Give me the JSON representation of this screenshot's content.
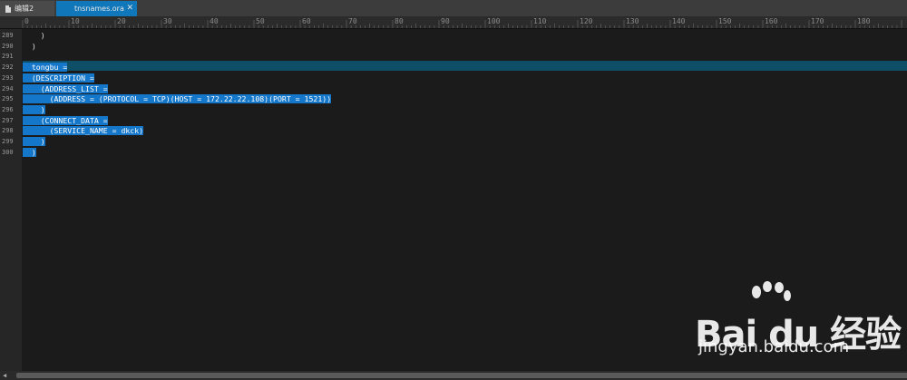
{
  "tabs": [
    {
      "label": "编辑2",
      "active": false
    },
    {
      "label": "tnsnames.ora",
      "active": true,
      "close": "✕"
    }
  ],
  "ruler": {
    "marks": [
      "0",
      "10",
      "20",
      "30",
      "40",
      "50",
      "60",
      "70",
      "80",
      "90",
      "100",
      "110",
      "120",
      "130",
      "140",
      "150",
      "160",
      "170",
      "180"
    ]
  },
  "lines": [
    {
      "num": "289",
      "text": "    )",
      "selected": false
    },
    {
      "num": "290",
      "text": "  )",
      "selected": false
    },
    {
      "num": "291",
      "text": "",
      "selected": false
    },
    {
      "num": "292",
      "text": "  tongbu =",
      "selected": true
    },
    {
      "num": "293",
      "text": "  (DESCRIPTION =",
      "selected": true
    },
    {
      "num": "294",
      "text": "    (ADDRESS_LIST =",
      "selected": true
    },
    {
      "num": "295",
      "text": "      (ADDRESS = (PROTOCOL = TCP)(HOST = 172.22.22.108)(PORT = 1521))",
      "selected": true
    },
    {
      "num": "296",
      "text": "    )",
      "selected": true
    },
    {
      "num": "297",
      "text": "    (CONNECT_DATA =",
      "selected": true
    },
    {
      "num": "298",
      "text": "      (SERVICE_NAME = dkck)",
      "selected": true
    },
    {
      "num": "299",
      "text": "    )",
      "selected": true
    },
    {
      "num": "300",
      "text": "  )",
      "selected": true
    }
  ],
  "watermark": {
    "brand": "Bai du 经验",
    "url": "jingyan.baidu.com"
  },
  "colors": {
    "tab_active": "#1177bb",
    "selection": "#1577c9",
    "current_line": "#0e4f67",
    "editor_bg": "#1b1b1b"
  }
}
